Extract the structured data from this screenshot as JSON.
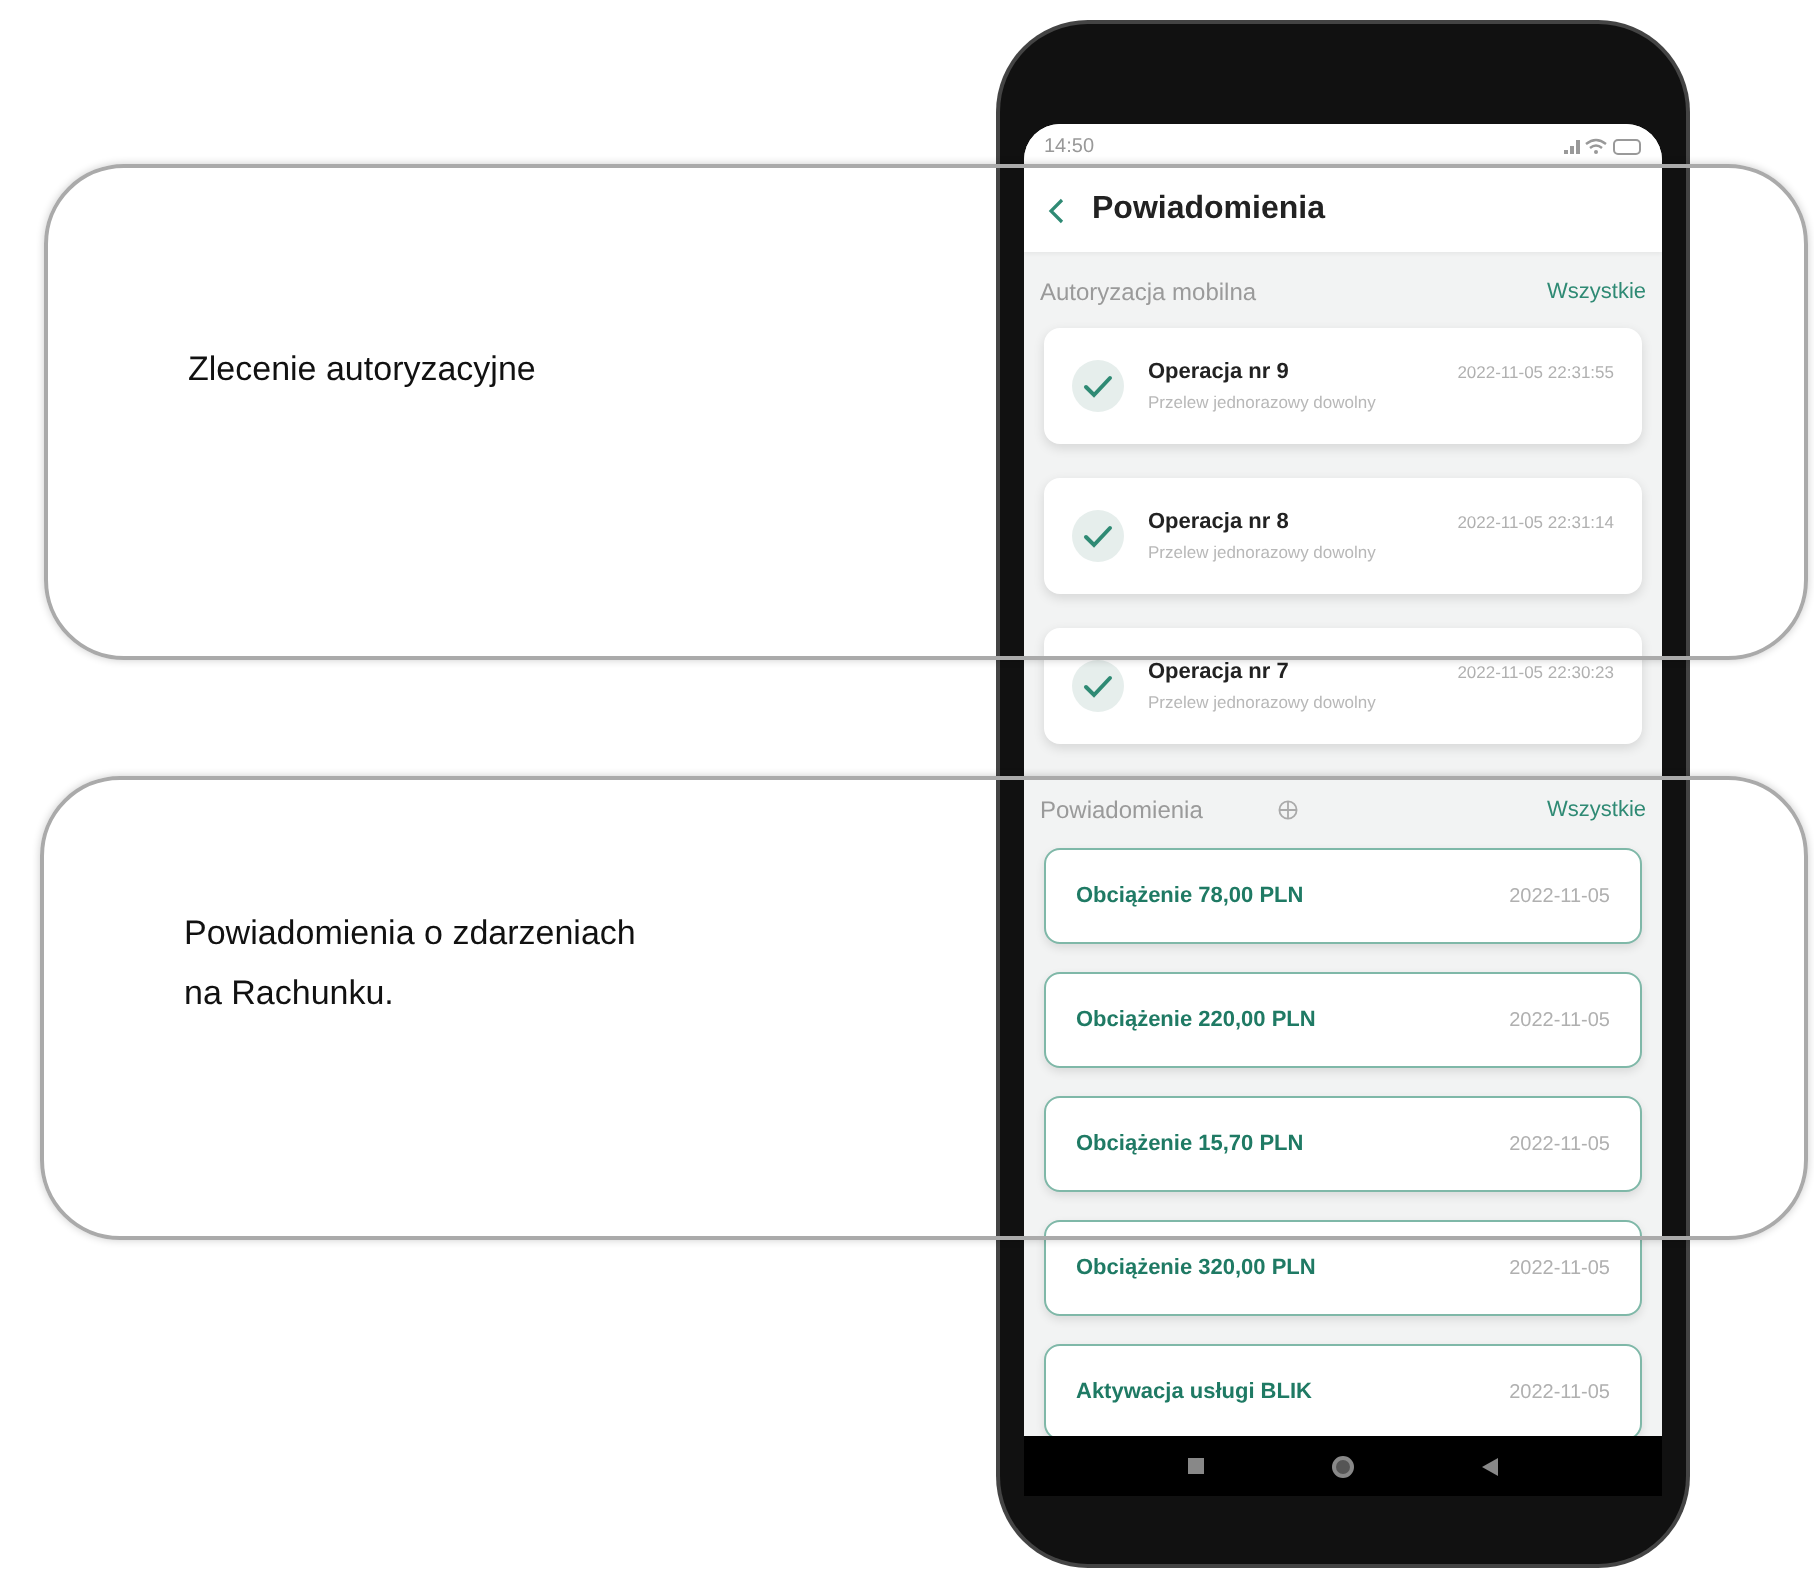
{
  "annotations": [
    {
      "text": "Zlecenie autoryzacyjne"
    },
    {
      "text": "Powiadomienia o zdarzeniach na Rachunku."
    }
  ],
  "phone": {
    "status_time": "14:50",
    "header": {
      "title": "Powiadomienia"
    },
    "sections": [
      {
        "kind": "authorizations",
        "title": "Autoryzacja mobilna",
        "link": "Wszystkie",
        "items": [
          {
            "title": "Operacja nr 9",
            "subtitle": "Przelew jednorazowy dowolny",
            "time": "2022-11-05 22:31:55"
          },
          {
            "title": "Operacja nr 8",
            "subtitle": "Przelew jednorazowy dowolny",
            "time": "2022-11-05 22:31:14"
          },
          {
            "title": "Operacja nr 7",
            "subtitle": "Przelew jednorazowy dowolny",
            "time": "2022-11-05 22:30:23"
          }
        ]
      },
      {
        "kind": "notifications",
        "title": "Powiadomienia",
        "link": "Wszystkie",
        "items": [
          {
            "title": "Obciążenie 78,00 PLN",
            "time": "2022-11-05"
          },
          {
            "title": "Obciążenie 220,00 PLN",
            "time": "2022-11-05"
          },
          {
            "title": "Obciążenie 15,70 PLN",
            "time": "2022-11-05"
          },
          {
            "title": "Obciążenie 320,00 PLN",
            "time": "2022-11-05"
          },
          {
            "title": "Aktywacja usługi BLIK",
            "time": "2022-11-05"
          }
        ]
      }
    ]
  }
}
